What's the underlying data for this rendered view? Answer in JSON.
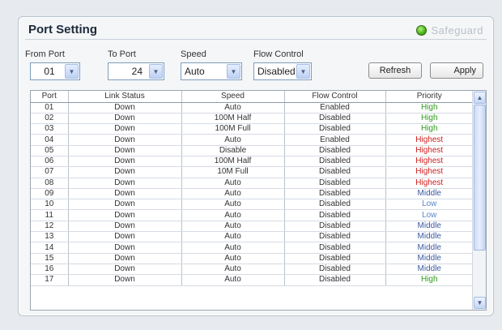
{
  "window": {
    "title": "Port Setting",
    "brand": "Safeguard"
  },
  "controls": {
    "from_port": {
      "label": "From Port",
      "value": "01"
    },
    "to_port": {
      "label": "To Port",
      "value": "24"
    },
    "speed": {
      "label": "Speed",
      "value": "Auto"
    },
    "flow_control": {
      "label": "Flow Control",
      "value": "Disabled"
    },
    "refresh_label": "Refresh",
    "apply_label": "Apply"
  },
  "table": {
    "columns": [
      "Port",
      "Link Status",
      "Speed",
      "Flow Control",
      "Priority"
    ],
    "rows": [
      [
        "01",
        "Down",
        "Auto",
        "Enabled",
        "High"
      ],
      [
        "02",
        "Down",
        "100M Half",
        "Disabled",
        "High"
      ],
      [
        "03",
        "Down",
        "100M Full",
        "Disabled",
        "High"
      ],
      [
        "04",
        "Down",
        "Auto",
        "Enabled",
        "Highest"
      ],
      [
        "05",
        "Down",
        "Disable",
        "Disabled",
        "Highest"
      ],
      [
        "06",
        "Down",
        "100M Half",
        "Disabled",
        "Highest"
      ],
      [
        "07",
        "Down",
        "10M Full",
        "Disabled",
        "Highest"
      ],
      [
        "08",
        "Down",
        "Auto",
        "Disabled",
        "Highest"
      ],
      [
        "09",
        "Down",
        "Auto",
        "Disabled",
        "Middle"
      ],
      [
        "10",
        "Down",
        "Auto",
        "Disabled",
        "Low"
      ],
      [
        "11",
        "Down",
        "Auto",
        "Disabled",
        "Low"
      ],
      [
        "12",
        "Down",
        "Auto",
        "Disabled",
        "Middle"
      ],
      [
        "13",
        "Down",
        "Auto",
        "Disabled",
        "Middle"
      ],
      [
        "14",
        "Down",
        "Auto",
        "Disabled",
        "Middle"
      ],
      [
        "15",
        "Down",
        "Auto",
        "Disabled",
        "Middle"
      ],
      [
        "16",
        "Down",
        "Auto",
        "Disabled",
        "Middle"
      ],
      [
        "17",
        "Down",
        "Auto",
        "Disabled",
        "High"
      ]
    ]
  },
  "colors": {
    "priority_high": "#2e9d1c",
    "priority_highest": "#d02020",
    "priority_middle": "#3b5aa3",
    "priority_low": "#5a87c8",
    "status_indicator": "#4db51a"
  },
  "icons": {
    "dropdown": "chevron-down-icon",
    "status": "status-led-icon",
    "scroll_up": "arrow-up-icon",
    "scroll_down": "arrow-down-icon"
  }
}
